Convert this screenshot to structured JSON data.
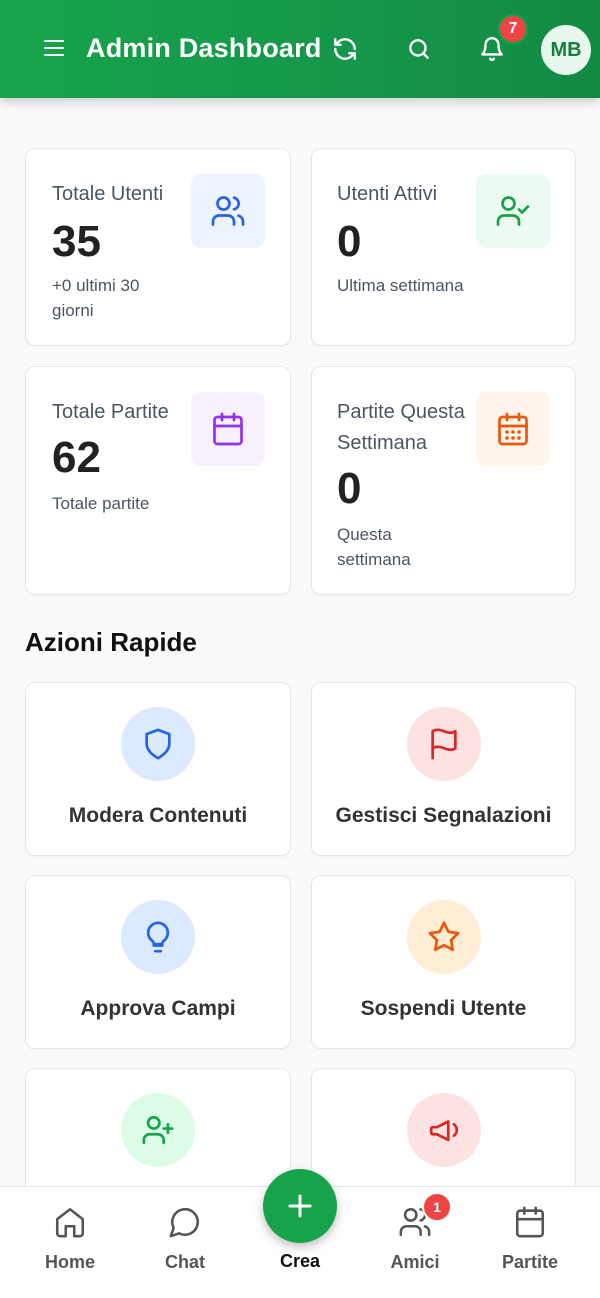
{
  "header": {
    "title": "Admin Dashboard",
    "notification_count": "7",
    "avatar_initials": "MB",
    "icons": [
      "menu-icon",
      "refresh-icon",
      "search-icon",
      "bell-icon"
    ]
  },
  "stats": [
    {
      "label": "Totale Utenti",
      "value": "35",
      "sub": "+0 ultimi 30 giorni",
      "icon": "users-icon",
      "icon_color": "#2563eb",
      "icon_bg": "#eef4ff"
    },
    {
      "label": "Utenti Attivi",
      "value": "0",
      "sub": "Ultima settimana",
      "icon": "user-check-icon",
      "icon_color": "#16a34a",
      "icon_bg": "#ecfbf1"
    },
    {
      "label": "Totale Partite",
      "value": "62",
      "sub": "Totale partite",
      "icon": "calendar-icon",
      "icon_color": "#9333ea",
      "icon_bg": "#f6f0ff"
    },
    {
      "label": "Partite Questa Settimana",
      "value": "0",
      "sub": "Questa settimana",
      "icon": "calendar-days-icon",
      "icon_color": "#ea580c",
      "icon_bg": "#fff5ea"
    }
  ],
  "quick_actions": {
    "title": "Azioni Rapide",
    "items": [
      {
        "label": "Modera Contenuti",
        "icon": "shield-icon",
        "icon_color": "#2563eb",
        "circle_bg": "#dbeafe"
      },
      {
        "label": "Gestisci Segnalazioni",
        "icon": "flag-icon",
        "icon_color": "#dc2626",
        "circle_bg": "#fde2e2"
      },
      {
        "label": "Approva Campi",
        "icon": "lightbulb-icon",
        "icon_color": "#2563eb",
        "circle_bg": "#dbeafe"
      },
      {
        "label": "Sospendi Utente",
        "icon": "star-icon",
        "icon_color": "#ea580c",
        "circle_bg": "#ffedd5"
      },
      {
        "label": "",
        "icon": "user-plus-icon",
        "icon_color": "#16a34a",
        "circle_bg": "#dcfce7"
      },
      {
        "label": "",
        "icon": "megaphone-icon",
        "icon_color": "#dc2626",
        "circle_bg": "#fde2e2"
      }
    ]
  },
  "bottom_nav": {
    "items": [
      {
        "label": "Home",
        "icon": "home-icon"
      },
      {
        "label": "Chat",
        "icon": "chat-icon"
      },
      {
        "label": "Amici",
        "icon": "friends-icon",
        "badge": "1"
      },
      {
        "label": "Partite",
        "icon": "calendar-icon"
      }
    ],
    "fab_label": "Crea",
    "fab_icon": "plus-icon"
  },
  "colors": {
    "brand": "#16a34a",
    "badge": "#ef4444"
  }
}
